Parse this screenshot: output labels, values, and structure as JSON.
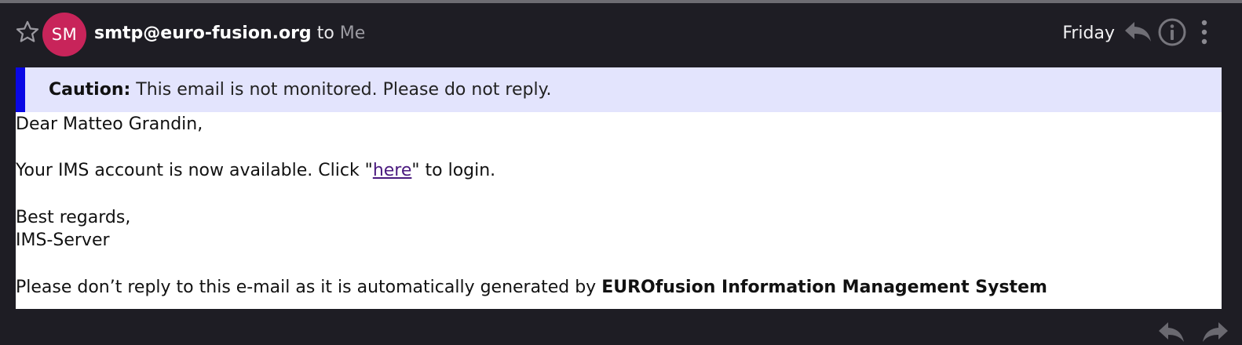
{
  "header": {
    "avatar_initials": "SM",
    "sender": "smtp@euro-fusion.org",
    "to_word": "to",
    "recipient": "Me",
    "date": "Friday"
  },
  "icons": {
    "star": "star-outline",
    "reply": "reply-arrow",
    "info": "info-circle",
    "more": "vertical-ellipsis",
    "footer_reply": "reply-arrow",
    "footer_forward": "forward-arrow"
  },
  "caution": {
    "label": "Caution:",
    "text": "This email is not monitored. Please do not reply."
  },
  "body": {
    "greeting": "Dear Matteo Grandin,",
    "account_prefix": "Your IMS account is now available. Click \"",
    "link_text": "here",
    "account_suffix": "\" to login.",
    "regards": "Best regards,",
    "signature": "IMS-Server",
    "footer_prefix": "Please don’t reply to this e-mail as it is automatically generated by ",
    "footer_bold": "EUROfusion Information Management System"
  },
  "colors": {
    "background": "#1e1d24",
    "avatar": "#c8245a",
    "caution_bar": "#0a08e4",
    "caution_background": "#e3e4fd",
    "link": "#4b1a7f"
  }
}
